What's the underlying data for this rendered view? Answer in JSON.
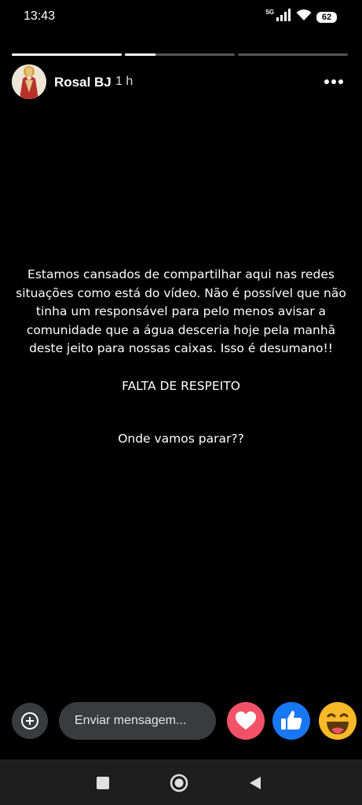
{
  "status": {
    "time": "13:43",
    "network": "5G",
    "battery": "62"
  },
  "story_progress": [
    1.0,
    0.28,
    0.0
  ],
  "header": {
    "user": "Rosal BJ",
    "time": "1 h"
  },
  "story": {
    "paragraph1": "Estamos cansados de compartilhar aqui nas redes situações como está do vídeo. Não é possível que não tinha um responsável para pelo menos avisar a comunidade que a água desceria hoje pela manhã deste jeito para nossas caixas. Isso é desumano!!",
    "paragraph2": "FALTA DE RESPEITO",
    "paragraph3": "Onde vamos parar??"
  },
  "composer": {
    "placeholder": "Enviar mensagem..."
  },
  "reactions": [
    {
      "name": "love",
      "color": "#f25268"
    },
    {
      "name": "like",
      "color": "#1877f2"
    },
    {
      "name": "haha",
      "color": "#f7b928"
    }
  ],
  "colors": {
    "background": "#000000",
    "input": "#3a3b3c",
    "navbar": "#1e1e1e"
  }
}
